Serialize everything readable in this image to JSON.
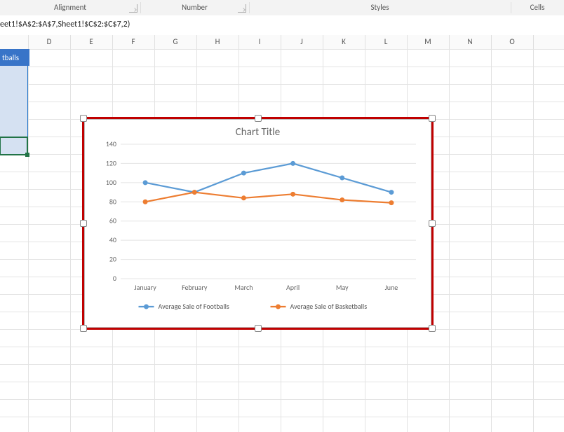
{
  "ribbon": {
    "groups": [
      "Alignment",
      "Number",
      "Styles",
      "Cells"
    ]
  },
  "formula_bar": {
    "content": "eet1!$A$2:$A$7,Sheet1!$C$2:$C$7,2)"
  },
  "columns": [
    "D",
    "E",
    "F",
    "G",
    "H",
    "I",
    "J",
    "K",
    "L",
    "M",
    "N",
    "O"
  ],
  "truncated_cell_text": "tballs",
  "chart_data": {
    "type": "line",
    "title": "Chart Title",
    "xlabel": "",
    "ylabel": "",
    "ylim": [
      0,
      140
    ],
    "yticks": [
      0,
      20,
      40,
      60,
      80,
      100,
      120,
      140
    ],
    "categories": [
      "January",
      "February",
      "March",
      "April",
      "May",
      "June"
    ],
    "series": [
      {
        "name": "Average Sale of Footballs",
        "values": [
          100,
          90,
          110,
          120,
          105,
          90
        ],
        "color": "#5b9bd5"
      },
      {
        "name": "Average Sale of Basketballs",
        "values": [
          80,
          90,
          84,
          88,
          82,
          79
        ],
        "color": "#ed7d31"
      }
    ],
    "legend_position": "bottom"
  }
}
